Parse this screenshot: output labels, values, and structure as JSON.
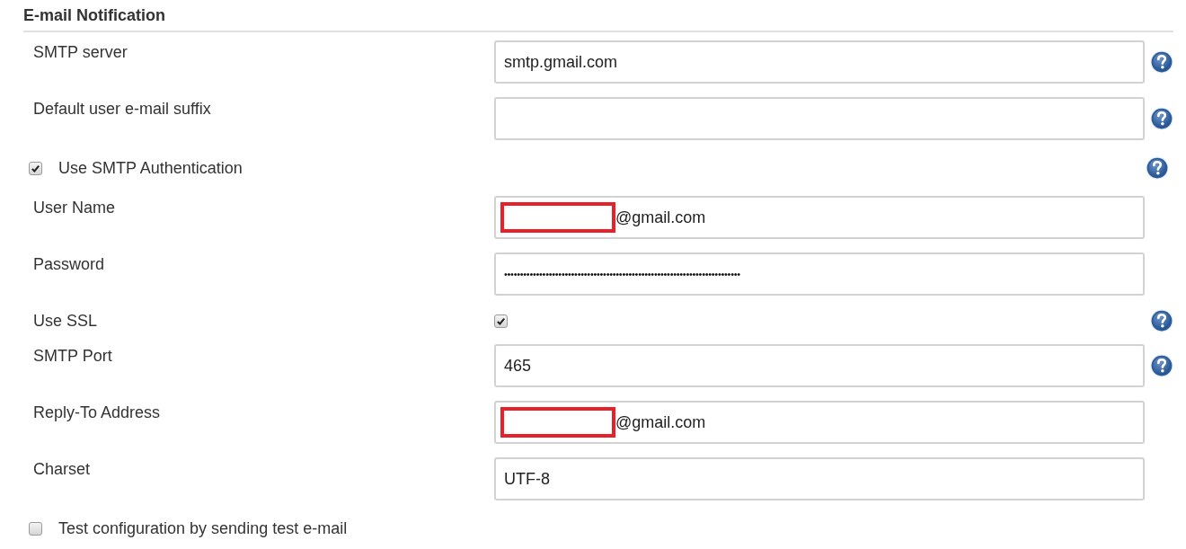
{
  "section": {
    "title": "E-mail Notification"
  },
  "rows": [
    {
      "kind": "text",
      "label": "SMTP server",
      "value": "smtp.gmail.com",
      "help": true
    },
    {
      "kind": "text",
      "label": "Default user e-mail suffix",
      "help": true
    },
    {
      "kind": "option",
      "label": "Use SMTP Authentication",
      "checked": true,
      "help": true
    },
    {
      "kind": "text",
      "label": "User Name",
      "value": "@gmail.com",
      "redacted": true,
      "help": false
    },
    {
      "kind": "password",
      "label": "Password",
      "value": "••••••••••••••••••••••••••••••••••••••••••••••••••••••••••••••••••••••••••",
      "help": false
    },
    {
      "kind": "checkbox",
      "label": "Use SSL",
      "checked": true,
      "help": true
    },
    {
      "kind": "text",
      "label": "SMTP Port",
      "value": "465",
      "help": true
    },
    {
      "kind": "text",
      "label": "Reply-To Address",
      "value": "@gmail.com",
      "redacted": true,
      "help": false
    },
    {
      "kind": "text",
      "label": "Charset",
      "value": "UTF-8",
      "help": false
    },
    {
      "kind": "option",
      "label": "Test configuration by sending test e-mail",
      "checked": false,
      "help": false
    }
  ]
}
